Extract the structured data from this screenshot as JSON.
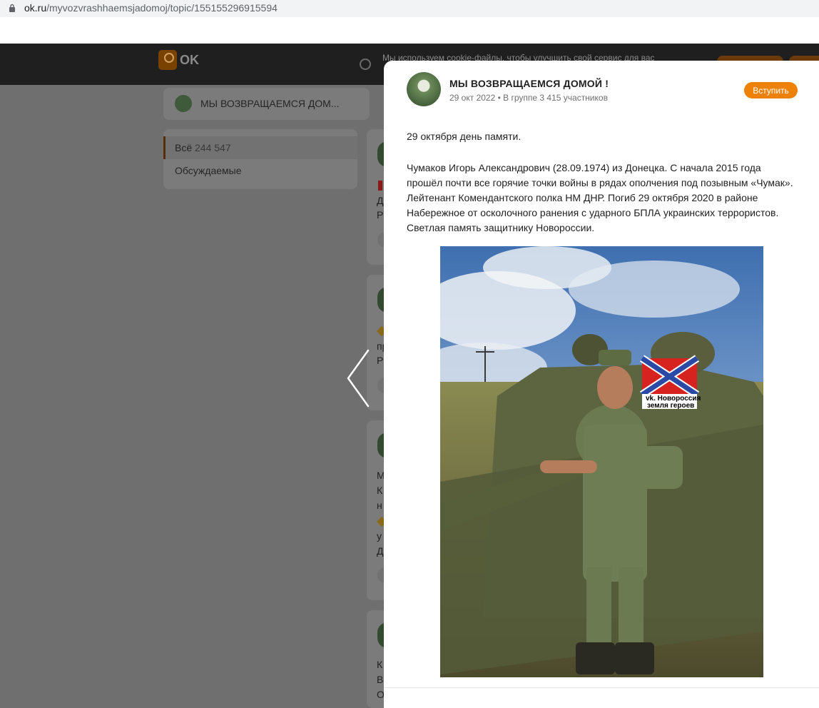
{
  "browser": {
    "url_host": "ok.ru",
    "url_path": "/myvozvrashhaemsjadomoj/topic/155155296915594"
  },
  "header": {
    "logo_text": "OK",
    "cookie_notice": "Мы используем cookie-файлы, чтобы улучшить свой сервис для вас"
  },
  "group_bar": {
    "name": "МЫ ВОЗВРАЩАЕМСЯ ДОМ..."
  },
  "filters": [
    {
      "label": "Всё",
      "count": "244 547"
    },
    {
      "label": "Обсуждаемые"
    }
  ],
  "feed_fragments": [
    "Д",
    "Р",
    "пр",
    "Р",
    "М",
    "К",
    "н",
    "у",
    "Д",
    "К",
    "В",
    "О"
  ],
  "modal": {
    "group_name": "МЫ ВОЗВРАЩАЕМСЯ ДОМОЙ !",
    "date": "29 окт 2022",
    "members_info": "В группе 3 415 участников",
    "join_label": "Вступить",
    "post_title": "29 октября день памяти.",
    "post_lines": [
      "Чумаков Игорь Александрович (28.09.1974) из Донецка. С начала 2015 года",
      "прошёл почти все горячие точки войны в рядах ополчения под позывным «Чумак».",
      "Лейтенант Комендантского полка НМ ДНР. Погиб 29 октября 2020 в районе",
      "Набережное от осколочного ранения с ударного БПЛА украинских террористов.",
      "Светлая память защитнику Новороссии."
    ],
    "photo": {
      "flag_caption_1": "vk. Новороссия",
      "flag_caption_2": "земля героев"
    }
  },
  "colors": {
    "accent": "#ee8208",
    "header_bg": "#1f1f1f",
    "overlay_bg": "#6f6f6f"
  }
}
